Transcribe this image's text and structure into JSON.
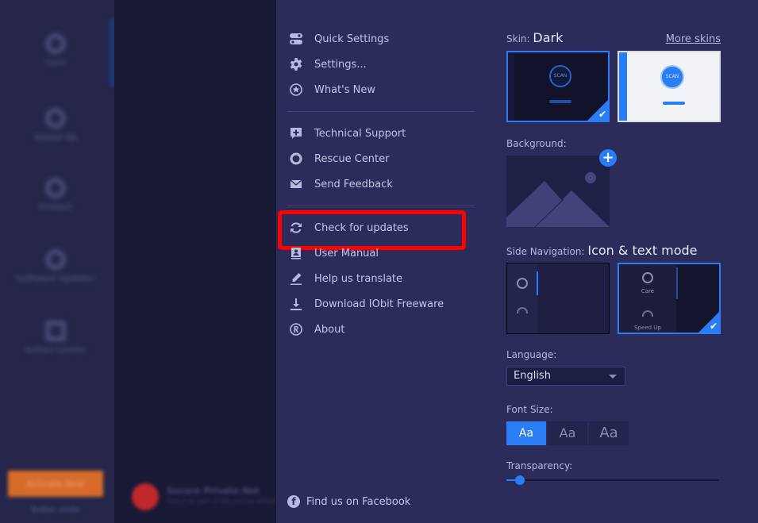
{
  "background_app": {
    "sidebar_items": [
      "Care",
      "Speed Up",
      "Protect",
      "Software Updater",
      "Action Center"
    ],
    "upgrade_button": "Activate Now",
    "enter_code_link": "Enter code",
    "promo_title": "Secure Private Net",
    "promo_subtitle": "Find it as part of the secure offering"
  },
  "menu": {
    "groups": [
      [
        {
          "label": "Quick Settings",
          "icon": "toggle-icon"
        },
        {
          "label": "Settings...",
          "icon": "gear-icon"
        },
        {
          "label": "What's New",
          "icon": "star-icon"
        }
      ],
      [
        {
          "label": "Technical Support",
          "icon": "support-chat-icon"
        },
        {
          "label": "Rescue Center",
          "icon": "lifebuoy-icon"
        },
        {
          "label": "Send Feedback",
          "icon": "envelope-icon"
        }
      ],
      [
        {
          "label": "Check for updates",
          "icon": "refresh-icon",
          "highlighted": true
        },
        {
          "label": "User Manual",
          "icon": "manual-icon"
        },
        {
          "label": "Help us translate",
          "icon": "pencil-icon"
        },
        {
          "label": "Download IObit Freeware",
          "icon": "download-icon"
        },
        {
          "label": "About",
          "icon": "registered-icon"
        }
      ]
    ],
    "facebook_label": "Find us on Facebook",
    "highlight_color": "#ff0000"
  },
  "settings": {
    "skin": {
      "label": "Skin:",
      "value": "Dark",
      "more_link": "More skins",
      "options": [
        {
          "name": "Dark",
          "selected": true,
          "scan_label": "SCAN"
        },
        {
          "name": "Light",
          "selected": false,
          "scan_label": "SCAN"
        }
      ]
    },
    "background": {
      "label": "Background:",
      "add_label": "+"
    },
    "side_navigation": {
      "label": "Side Navigation:",
      "value": "Icon & text mode",
      "options": [
        {
          "name": "Icon mode",
          "selected": false
        },
        {
          "name": "Icon & text mode",
          "selected": true,
          "item_labels": [
            "Care",
            "Speed Up"
          ]
        }
      ]
    },
    "language": {
      "label": "Language:",
      "value": "English"
    },
    "font_size": {
      "label": "Font Size:",
      "options": [
        "Aa",
        "Aa",
        "Aa"
      ],
      "selected_index": 0
    },
    "transparency": {
      "label": "Transparency:",
      "value_percent": 4
    },
    "accent_color": "#2a7df4"
  }
}
